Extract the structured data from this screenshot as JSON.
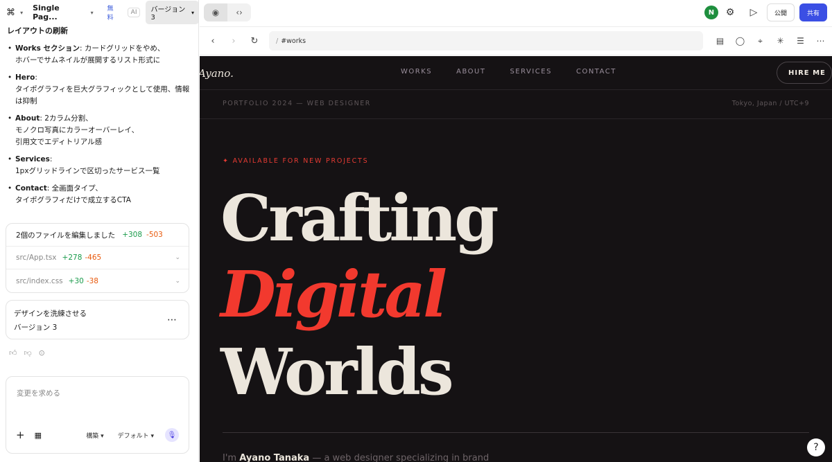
{
  "app": {
    "project_name": "Single Pag...",
    "free_badge": "無料",
    "ai_badge": "AI",
    "version_label": "バージョン 3"
  },
  "chat": {
    "heading": "レイアウトの刷新",
    "items": [
      {
        "title": "Works セクション",
        "line1": ": カードグリッドをやめ、",
        "line2": "ホバーでサムネイルが展開するリスト形式に"
      },
      {
        "title": "Hero",
        "line1": ":",
        "line2": "タイポグラフィを巨大グラフィックとして使用、情報は抑制"
      },
      {
        "title": "About",
        "line1": ": 2カラム分割、",
        "line2": "モノクロ写真にカラーオーバーレイ、",
        "line3": "引用文でエディトリアル感"
      },
      {
        "title": "Services",
        "line1": ":",
        "line2": "1pxグリッドラインで区切ったサービス一覧"
      },
      {
        "title": "Contact",
        "line1": ": 全画面タイプ、",
        "line2": "タイポグラフィだけで成立するCTA"
      }
    ]
  },
  "files": {
    "summary": "2個のファイルを編集しました",
    "total_add": "+308",
    "total_del": "-503",
    "list": [
      {
        "path": "src/App.tsx",
        "add": "+278",
        "del": "-465"
      },
      {
        "path": "src/index.css",
        "add": "+30",
        "del": "-38"
      }
    ]
  },
  "refine": {
    "title": "デザインを洗練させる",
    "version": "バージョン 3"
  },
  "composer": {
    "placeholder": "変更を求める",
    "mode_label": "構築",
    "model_label": "デフォルト"
  },
  "topbar": {
    "avatar_initial": "N",
    "publish_label": "公開",
    "share_label": "共有"
  },
  "browser": {
    "url": "#works"
  },
  "site": {
    "logo": "Ayano.",
    "nav": [
      "WORKS",
      "ABOUT",
      "SERVICES",
      "CONTACT"
    ],
    "hire_label": "HIRE ME",
    "sub_left": "PORTFOLIO 2024 — WEB DESIGNER",
    "sub_right": "Tokyo, Japan / UTC+9",
    "available": "✦ AVAILABLE FOR NEW PROJECTS",
    "hero_line1": "Crafting",
    "hero_line2": "Digital",
    "hero_line3": "Worlds",
    "intro_prefix": "I'm ",
    "intro_name": "Ayano Tanaka",
    "intro_suffix": " — a web designer specializing in brand"
  },
  "help_label": "?",
  "colors": {
    "accent_red": "#f2392e",
    "share_blue": "#3b4fe4",
    "preview_bg": "#151214",
    "add_green": "#1a9b4b",
    "del_orange": "#e8590c"
  }
}
